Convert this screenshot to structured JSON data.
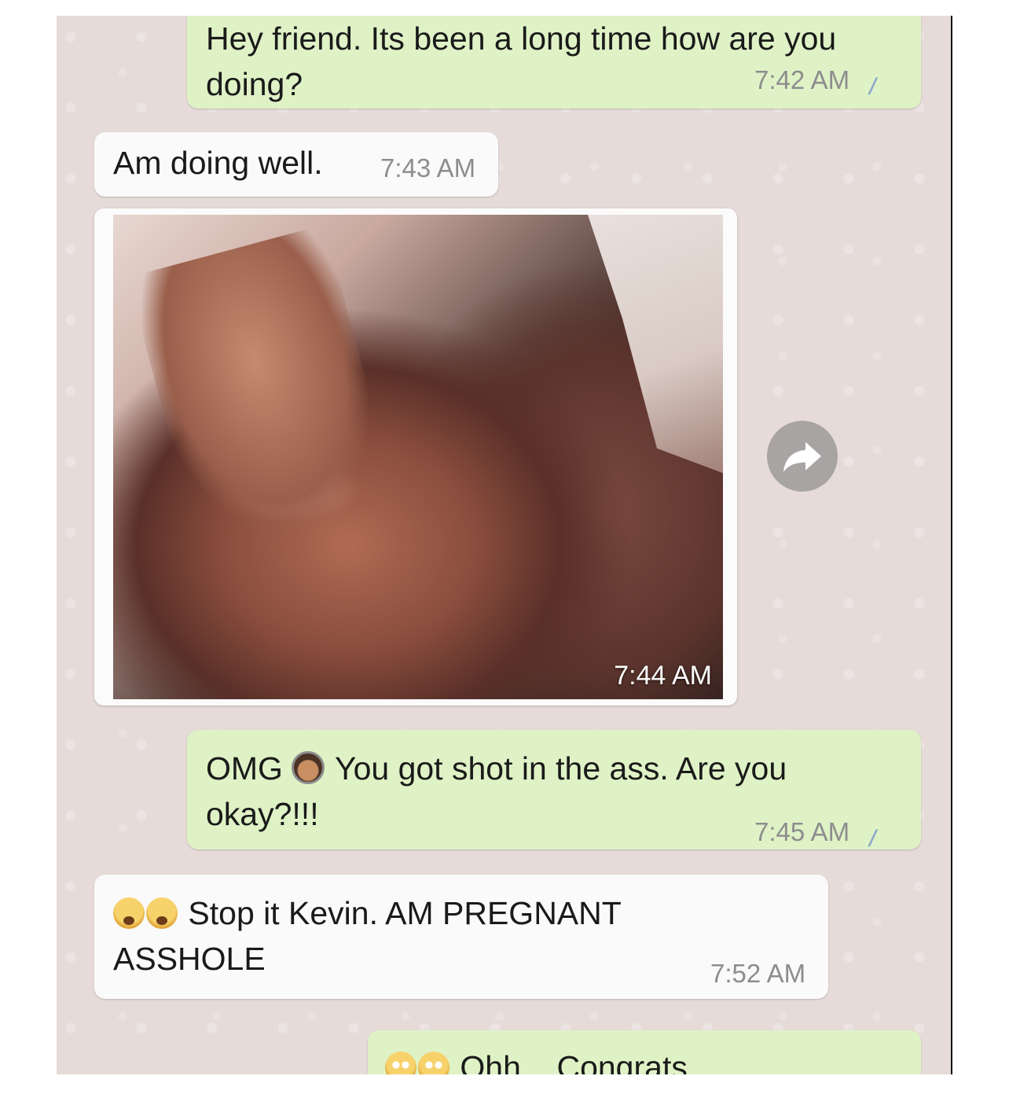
{
  "messages": [
    {
      "text": "Hey friend. Its been a long time how are you doing?",
      "time": "7:42 AM",
      "status": "read"
    },
    {
      "text": "Am doing well.",
      "time": "7:43 AM"
    },
    {
      "time": "7:44 AM"
    },
    {
      "text_prefix": "OMG",
      "text": "You got shot in the ass. Are you okay?!!!",
      "time": "7:45 AM",
      "status": "read"
    },
    {
      "text": "Stop it Kevin. AM PREGNANT ASSHOLE",
      "time": "7:52 AM"
    },
    {
      "text": "Ohh... Congrats"
    }
  ],
  "icons": {
    "forward": "forward-arrow-icon",
    "multi_select": "copy-icon",
    "read_receipt": "double-check-icon"
  },
  "colors": {
    "outgoing_bubble": "#dff2c6",
    "incoming_bubble": "#fafafa",
    "chat_background": "#e6dbd8",
    "timestamp": "#8d8d8d"
  }
}
